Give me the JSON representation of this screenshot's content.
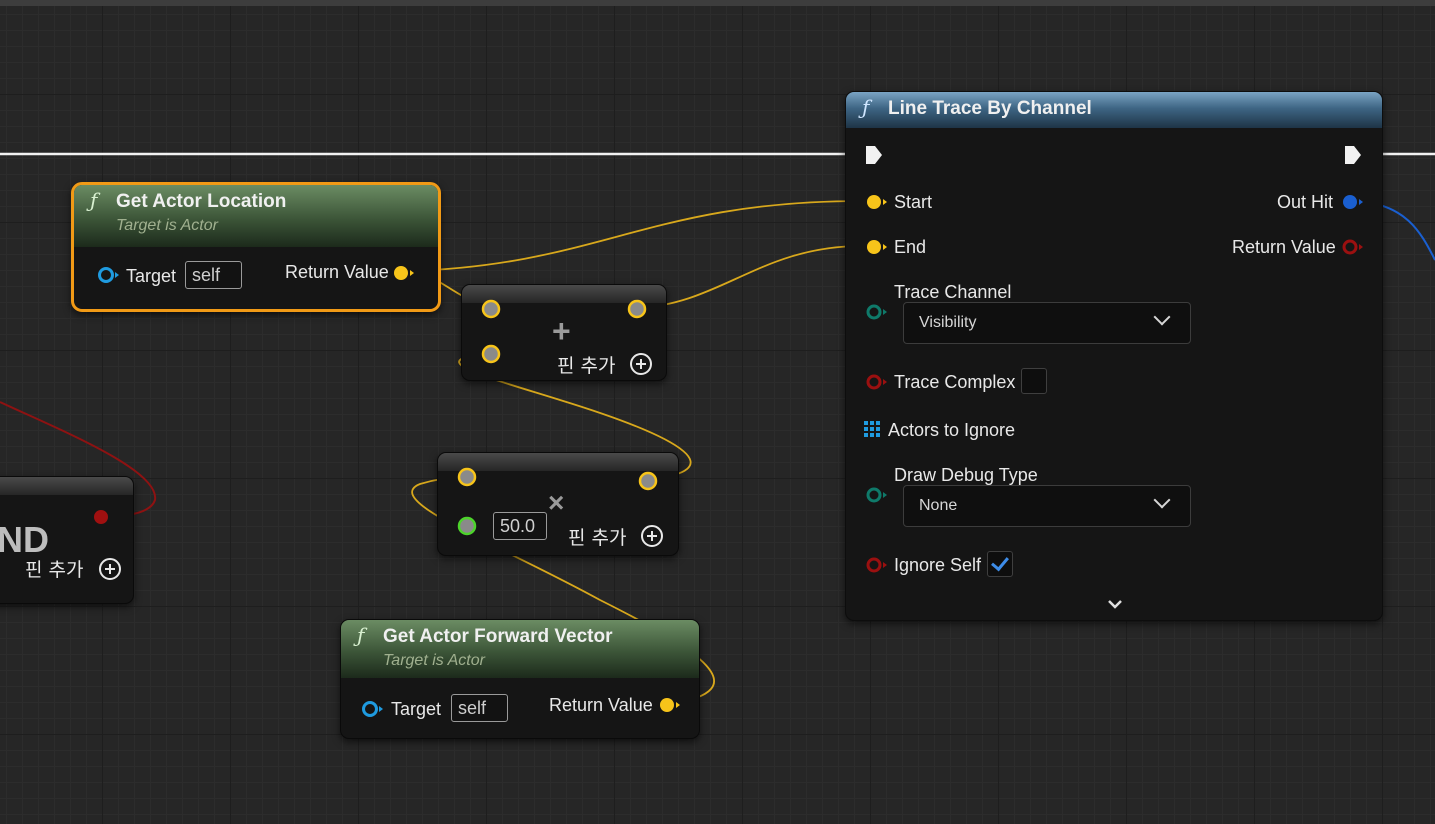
{
  "colors": {
    "exec_wire": "#f2f2f2",
    "vector_pin": "#f7c41a",
    "float_pin": "#4dd42b",
    "object_pin": "#1f9be0",
    "struct_pin": "#1a5fd0",
    "bool_pin": "#9b1010",
    "byte_pin": "#0f7a6a",
    "selection": "#f19a16"
  },
  "and_node": {
    "title_fragment": "ND",
    "add_pin_label": "핀 추가"
  },
  "get_actor_location": {
    "icon": "function-icon",
    "title": "Get Actor Location",
    "subtitle": "Target is Actor",
    "target_label": "Target",
    "target_value": "self",
    "return_label": "Return Value"
  },
  "add_node": {
    "operator": "+",
    "add_pin_label": "핀 추가"
  },
  "multiply_node": {
    "operator": "×",
    "float_value": "50.0",
    "add_pin_label": "핀 추가"
  },
  "get_actor_forward_vector": {
    "icon": "function-icon",
    "title": "Get Actor Forward Vector",
    "subtitle": "Target is Actor",
    "target_label": "Target",
    "target_value": "self",
    "return_label": "Return Value"
  },
  "line_trace": {
    "icon": "function-icon",
    "title": "Line Trace By Channel",
    "start_label": "Start",
    "end_label": "End",
    "out_hit_label": "Out Hit",
    "return_label": "Return Value",
    "trace_channel_label": "Trace Channel",
    "trace_channel_value": "Visibility",
    "trace_complex_label": "Trace Complex",
    "trace_complex_checked": false,
    "actors_to_ignore_label": "Actors to Ignore",
    "draw_debug_type_label": "Draw Debug Type",
    "draw_debug_type_value": "None",
    "ignore_self_label": "Ignore Self",
    "ignore_self_checked": true
  }
}
